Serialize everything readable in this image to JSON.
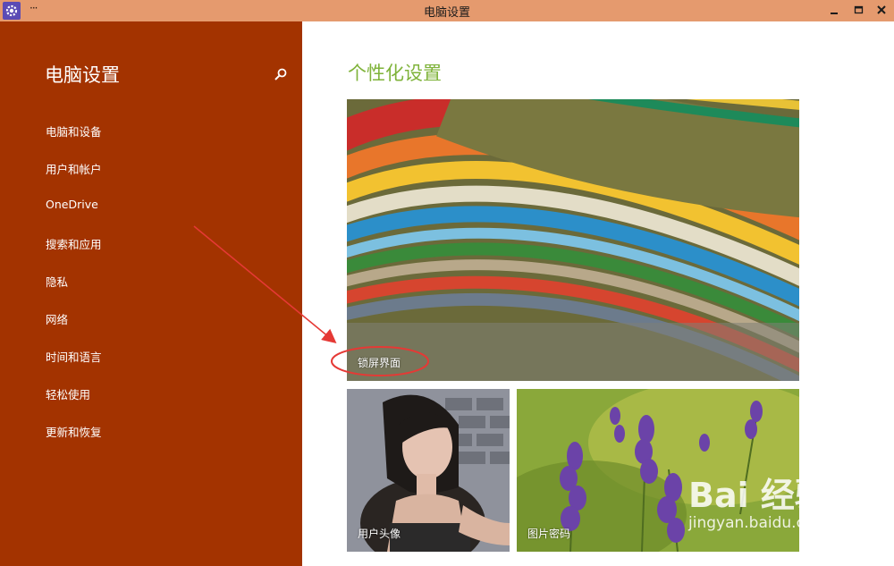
{
  "window": {
    "title": "电脑设置",
    "more_label": "···"
  },
  "sidebar": {
    "title": "电脑设置",
    "items": [
      {
        "label": "电脑和设备"
      },
      {
        "label": "用户和帐户"
      },
      {
        "label": "OneDrive"
      },
      {
        "label": "搜索和应用"
      },
      {
        "label": "隐私"
      },
      {
        "label": "网络"
      },
      {
        "label": "时间和语言"
      },
      {
        "label": "轻松使用"
      },
      {
        "label": "更新和恢复"
      }
    ]
  },
  "main": {
    "title": "个性化设置",
    "tiles": {
      "lock": "锁屏界面",
      "avatar": "用户头像",
      "password": "图片密码"
    }
  },
  "watermark": {
    "brand": "Bai 经验",
    "url": "jingyan.baidu.com"
  },
  "colors": {
    "sidebar": "#a33300",
    "titlebar": "#e59a6e",
    "accent_title": "#7fb33a",
    "annotation": "#e53935"
  }
}
